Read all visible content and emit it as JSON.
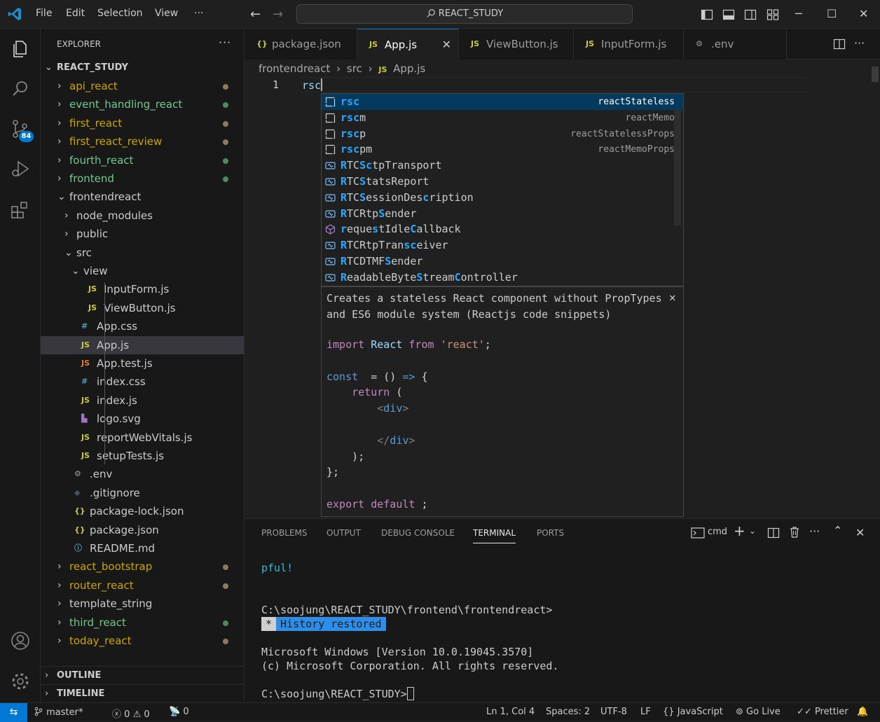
{
  "titlebar": {
    "menu": [
      "File",
      "Edit",
      "Selection",
      "View",
      "···"
    ],
    "search": "REACT_STUDY"
  },
  "activity": {
    "scm_badge": "84"
  },
  "explorer": {
    "title": "EXPLORER",
    "more": "···",
    "root": "REACT_STUDY",
    "items": [
      {
        "label": "api_react",
        "kind": "folder",
        "color": "#cca700",
        "dot": "#8d7a5b"
      },
      {
        "label": "event_handling_react",
        "kind": "folder",
        "color": "#73c991",
        "dot": "#4e8a5e"
      },
      {
        "label": "first_react",
        "kind": "folder",
        "color": "#cca700",
        "dot": "#8d7a5b"
      },
      {
        "label": "first_react_review",
        "kind": "folder",
        "color": "#cca700",
        "dot": "#8d7a5b"
      },
      {
        "label": "fourth_react",
        "kind": "folder",
        "color": "#73c991",
        "dot": "#4e8a5e"
      },
      {
        "label": "frontend",
        "kind": "folder",
        "color": "#73c991",
        "dot": "#4e8a5e"
      },
      {
        "label": "frontendreact",
        "kind": "folder-open",
        "color": "#cccccc"
      },
      {
        "label": "node_modules",
        "kind": "folder",
        "color": "#cccccc"
      },
      {
        "label": "public",
        "kind": "folder",
        "color": "#cccccc"
      },
      {
        "label": "src",
        "kind": "folder-open",
        "color": "#cccccc"
      },
      {
        "label": "view",
        "kind": "folder-open",
        "color": "#cccccc"
      },
      {
        "label": "InputForm.js",
        "kind": "js",
        "color": "#cccccc"
      },
      {
        "label": "ViewButton.js",
        "kind": "js",
        "color": "#cccccc"
      },
      {
        "label": "App.css",
        "kind": "css",
        "color": "#cccccc"
      },
      {
        "label": "App.js",
        "kind": "js",
        "color": "#cccccc"
      },
      {
        "label": "App.test.js",
        "kind": "jstest",
        "color": "#cccccc"
      },
      {
        "label": "index.css",
        "kind": "css",
        "color": "#cccccc"
      },
      {
        "label": "index.js",
        "kind": "js",
        "color": "#cccccc"
      },
      {
        "label": "logo.svg",
        "kind": "svg",
        "color": "#cccccc"
      },
      {
        "label": "reportWebVitals.js",
        "kind": "js",
        "color": "#cccccc"
      },
      {
        "label": "setupTests.js",
        "kind": "js",
        "color": "#cccccc"
      },
      {
        "label": ".env",
        "kind": "env",
        "color": "#cccccc"
      },
      {
        "label": ".gitignore",
        "kind": "git",
        "color": "#cccccc"
      },
      {
        "label": "package-lock.json",
        "kind": "json",
        "color": "#cccccc"
      },
      {
        "label": "package.json",
        "kind": "json",
        "color": "#cccccc"
      },
      {
        "label": "README.md",
        "kind": "info",
        "color": "#cccccc"
      },
      {
        "label": "react_bootstrap",
        "kind": "folder",
        "color": "#cca700",
        "dot": "#8d7a5b"
      },
      {
        "label": "router_react",
        "kind": "folder",
        "color": "#cca700",
        "dot": "#8d7a5b"
      },
      {
        "label": "template_string",
        "kind": "folder",
        "color": "#cccccc"
      },
      {
        "label": "third_react",
        "kind": "folder",
        "color": "#73c991",
        "dot": "#4e8a5e"
      },
      {
        "label": "today_react",
        "kind": "folder",
        "color": "#cca700",
        "dot": "#8d7a5b"
      }
    ],
    "outline": "OUTLINE",
    "timeline": "TIMELINE"
  },
  "tabs": [
    {
      "label": "package.json",
      "icon": "{}",
      "icon_color": "#cbcb41"
    },
    {
      "label": "App.js",
      "icon": "JS",
      "icon_color": "#cbcb41",
      "active": true
    },
    {
      "label": "ViewButton.js",
      "icon": "JS",
      "icon_color": "#cbcb41"
    },
    {
      "label": "InputForm.js",
      "icon": "JS",
      "icon_color": "#cbcb41"
    },
    {
      "label": ".env",
      "icon": "⚙",
      "icon_color": "#9d9d9d"
    }
  ],
  "editor": {
    "breadcrumb": [
      "frontendreact",
      "›",
      "src",
      "›",
      "JS",
      "App.js"
    ],
    "line_number": "1",
    "code": "rsc"
  },
  "suggest": [
    {
      "label": "rsc",
      "detail": "reactStateless",
      "icon": "snippet"
    },
    {
      "label": "rscm",
      "detail": "reactMemo",
      "icon": "snippet"
    },
    {
      "label": "rscp",
      "detail": "reactStatelessProps",
      "icon": "snippet"
    },
    {
      "label": "rscpm",
      "detail": "reactMemoProps",
      "icon": "snippet"
    },
    {
      "label": "RTCSctpTransport",
      "detail": "",
      "icon": "variable"
    },
    {
      "label": "RTCStatsReport",
      "detail": "",
      "icon": "variable"
    },
    {
      "label": "RTCSessionDescription",
      "detail": "",
      "icon": "variable"
    },
    {
      "label": "RTCRtpSender",
      "detail": "",
      "icon": "variable"
    },
    {
      "label": "requestIdleCallback",
      "detail": "",
      "icon": "method"
    },
    {
      "label": "RTCRtpTransceiver",
      "detail": "",
      "icon": "variable"
    },
    {
      "label": "RTCDTMFSender",
      "detail": "",
      "icon": "variable"
    },
    {
      "label": "ReadableByteStreamController",
      "detail": "",
      "icon": "variable"
    }
  ],
  "docs": {
    "description": "Creates a stateless React component without PropTypes and ES6 module system (Reactjs code snippets)"
  },
  "panel": {
    "tabs": [
      "PROBLEMS",
      "OUTPUT",
      "DEBUG CONSOLE",
      "TERMINAL",
      "PORTS"
    ],
    "shell": "cmd",
    "terminal": {
      "line1": "pful!",
      "prompt1": "C:\\soojung\\REACT_STUDY\\frontend\\frontendreact>",
      "history_star": "*",
      "history": "History restored",
      "version": "Microsoft Windows [Version 10.0.19045.3570]",
      "copyright": "(c) Microsoft Corporation. All rights reserved.",
      "prompt2": "C:\\soojung\\REACT_STUDY>"
    }
  },
  "status": {
    "branch": "master*",
    "errors": "0",
    "warnings": "0",
    "ports": "0",
    "position": "Ln 1, Col 4",
    "spaces": "Spaces: 2",
    "encoding": "UTF-8",
    "eol": "LF",
    "language": "JavaScript",
    "golive": "Go Live",
    "prettier": "Prettier"
  }
}
